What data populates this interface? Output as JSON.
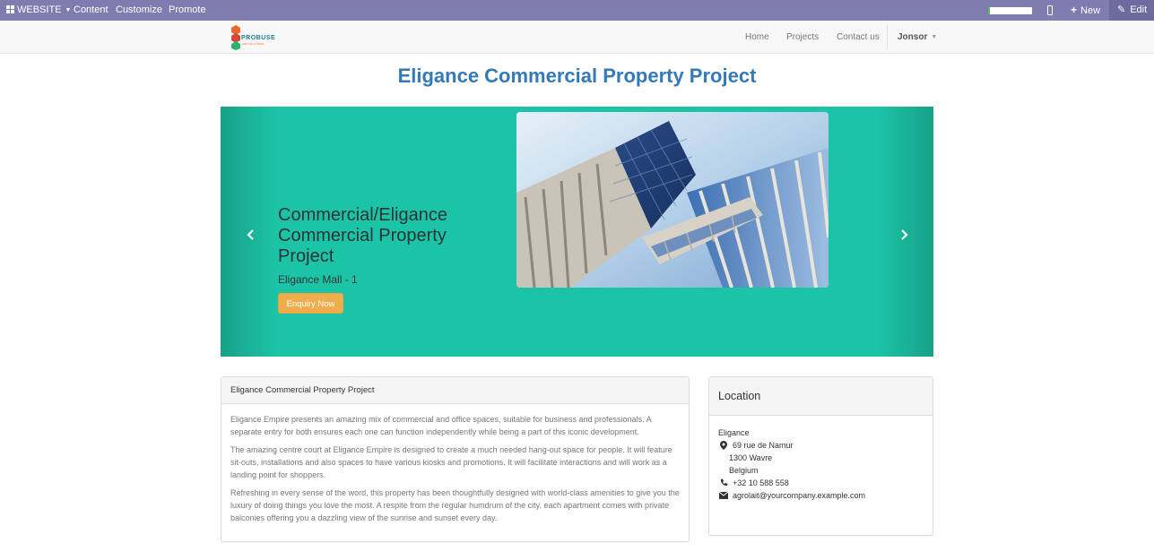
{
  "adminbar": {
    "website_label": "WEBSITE",
    "menu": [
      "Content",
      "Customize",
      "Promote"
    ],
    "progress": 0.05,
    "new_label": "New",
    "edit_label": "Edit"
  },
  "navbar": {
    "logo_text": "PROBUSE",
    "logo_subtext": "ERP SOLUTIONS",
    "links": [
      "Home",
      "Projects",
      "Contact us"
    ],
    "user": "Jonsor"
  },
  "page_title": "Eligance Commercial Property Project",
  "carousel": {
    "heading": "Commercial/Eligance Commercial Property Project",
    "subheading": "Eligance Mall - 1",
    "button_label": "Enquiry Now"
  },
  "description_panel": {
    "title": "Eligance Commercial Property Project",
    "paragraphs": [
      "Eligance Empire presents an amazing mix of commercial and office spaces, suitable for business and professionals. A separate entry for both ensures each one can function independently while being a part of this iconic development.",
      "The amazing centre court at Eligance Empire is designed to create a much needed hang-out space for people. It will feature sit-outs, installations and also spaces to have various kiosks and promotions. It will facilitate interactions and will work as a landing point for shoppers.",
      "Refreshing in every sense of the word, this property has been thoughtfully designed with world-class amenities to give you the luxury of doing things you love the most. A respite from the regular humdrum of the city, each apartment comes with private balconies offering you a dazzling view of the sunrise and sunset every day."
    ]
  },
  "location_panel": {
    "title": "Location",
    "company": "Eligance",
    "street": "69 rue de Namur",
    "city": "1300 Wavre",
    "country": "Belgium",
    "phone": "+32 10 588 558",
    "email": "agrolait@yourcompany.example.com"
  },
  "colors": {
    "admin_bar": "#7f7cb0",
    "carousel_bg": "#1cc4a7",
    "title_blue": "#337ab7",
    "button_orange": "#f0ad4e"
  },
  "icons": [
    "grid-icon",
    "phone-icon",
    "plus-icon",
    "pencil-icon",
    "chevron-left-icon",
    "chevron-right-icon",
    "map-marker-icon",
    "phone-icon",
    "envelope-icon"
  ]
}
